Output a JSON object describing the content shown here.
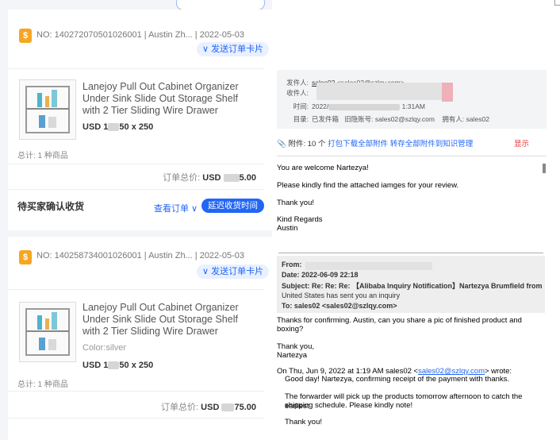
{
  "orders": [
    {
      "order_no": "NO: 140272070501026001 | Austin Zh... | 2022-05-03",
      "send_card_label": "∨ 发送订单卡片",
      "product_title": "Lanejoy Pull Out Cabinet Organizer Under Sink Slide Out Storage Shelf with 2 Tier Sliding Wire Drawer",
      "color": "",
      "price_prefix": "USD 1",
      "price_suffix": "50 x 250",
      "total_items": "总计: 1 种商品",
      "total_label": "订单总价:",
      "total_prefix": "USD",
      "total_suffix": "5.00",
      "status": "待买家确认收货",
      "view_order": "查看订单 ∨",
      "extend_button": "延迟收货时间"
    },
    {
      "order_no": "NO: 140258734001026001 | Austin Zh... | 2022-05-03",
      "send_card_label": "∨ 发送订单卡片",
      "product_title": "Lanejoy Pull Out Cabinet Organizer Under Sink Slide Out Storage Shelf with 2 Tier Sliding Wire Drawer",
      "color": "Color:silver",
      "price_prefix": "USD 1",
      "price_suffix": "50 x 250",
      "total_items": "总计: 1 种商品",
      "total_label": "订单总价:",
      "total_prefix": "USD",
      "total_suffix": "75.00"
    }
  ],
  "email": {
    "from_label": "发件人:",
    "from_name": "sales02",
    "from_addr": "<sales02@szlqy.com>",
    "to_label": "收件人:",
    "time_label": "时间:",
    "time_value": "2022/",
    "time_extra": "1:31AM",
    "dir_label": "目录:",
    "dir_value": "已发件箱",
    "account_label": "旧隐账号:",
    "account_value": "sales02@szlqy.com",
    "owner_label": "拥有人:",
    "owner_value": "sales02",
    "attach_prefix": "附件:",
    "attach_count": "10 个",
    "attach_download": "打包下载全部附件",
    "attach_save": "转存全部附件到知识管理",
    "attach_show": "显示",
    "body_lines": [
      "You are welcome Nartezya!",
      "Please kindly find the attached iamges for your review.",
      "Thank you!",
      "Kind Regards",
      "Austin"
    ],
    "quote": {
      "from": "From:",
      "date": "Date:  2022-06-09 22:18",
      "subject": "Subject:  Re: Re: Re: 【Alibaba Inquiry Notification】Nartezya Brumfield from",
      "subject2": "United States has sent you an inquiry",
      "to": "To:  sales02 <sales02@szlqy.com>"
    },
    "reply_lines": [
      "Thanks for confirming. Austin, can you share a pic of finished product and",
      "boxing?",
      "Thank you,",
      "Nartezya"
    ],
    "on_date_prefix": "On Thu, Jun 9, 2022 at 1:19 AM sales02 <",
    "on_date_link": "sales02@szlqy.com",
    "on_date_suffix": "> wrote:",
    "quoted_lines": [
      "Good day! Nartezya, confirming receipt of the payment with thanks.",
      "The forwarder will pick up the products tomorrow afternoon to catch the earliest",
      "shipping schedule. Please kindly note!",
      "Thank you!"
    ]
  },
  "colors": {
    "accent": "#2266f5",
    "coin": "#f5a623",
    "alert": "#ee3333"
  }
}
